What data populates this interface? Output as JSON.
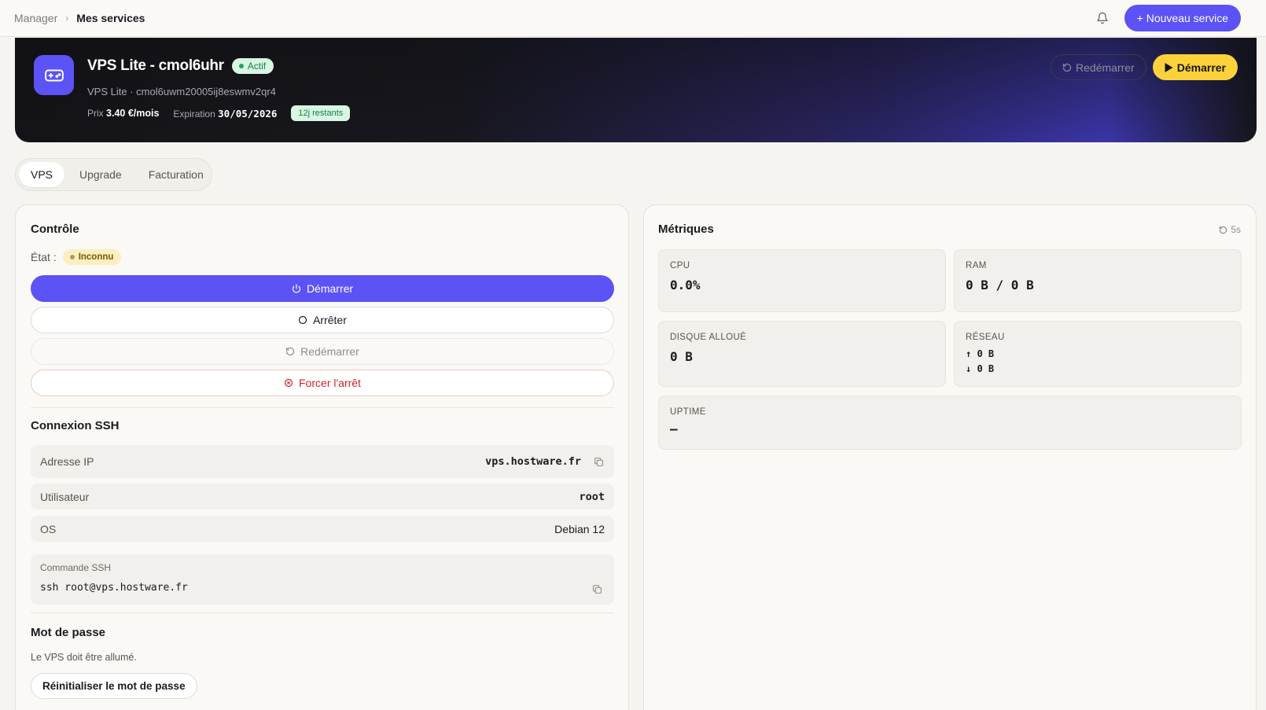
{
  "breadcrumb": {
    "root": "Manager",
    "current": "Mes services"
  },
  "topbar": {
    "new_service_label": "+ Nouveau service"
  },
  "hero": {
    "title": "VPS Lite - cmol6uhr",
    "status": "Actif",
    "subtitle": "VPS Lite · cmol6uwm20005ij8eswmv2qr4",
    "price_label": "Prix",
    "price_value": "3.40 €/mois",
    "expiration_label": "Expiration",
    "expiration_value": "30/05/2026",
    "days_left": "12j restants",
    "restart_label": "Redémarrer",
    "start_label": "Démarrer"
  },
  "tabs": [
    {
      "label": "VPS"
    },
    {
      "label": "Upgrade"
    },
    {
      "label": "Facturation"
    }
  ],
  "controle": {
    "title": "Contrôle",
    "state_label": "État :",
    "state_value": "Inconnu",
    "start_label": "Démarrer",
    "stop_label": "Arrêter",
    "restart_label": "Redémarrer",
    "force_stop_label": "Forcer l'arrêt"
  },
  "ssh": {
    "title": "Connexion SSH",
    "ip_label": "Adresse IP",
    "ip_value": "vps.hostware.fr",
    "user_label": "Utilisateur",
    "user_value": "root",
    "os_label": "OS",
    "os_value": "Debian 12",
    "command_label": "Commande SSH",
    "command_value": "ssh root@vps.hostware.fr"
  },
  "password": {
    "title": "Mot de passe",
    "note": "Le VPS doit être allumé.",
    "reset_label": "Réinitialiser le mot de passe"
  },
  "metrics": {
    "title": "Métriques",
    "refresh": "5s",
    "cpu_label": "CPU",
    "cpu_value": "0.0%",
    "ram_label": "RAM",
    "ram_value": "0 B / 0 B",
    "disk_label": "DISQUE ALLOUÉ",
    "disk_value": "0 B",
    "network_label": "RÉSEAU",
    "network_up": "↑ 0 B",
    "network_down": "↓ 0 B",
    "uptime_label": "UPTIME",
    "uptime_value": "—"
  },
  "colors": {
    "accent": "#5b53f5",
    "warning": "#fcd13a",
    "success": "#14804a",
    "danger": "#d3212d"
  }
}
